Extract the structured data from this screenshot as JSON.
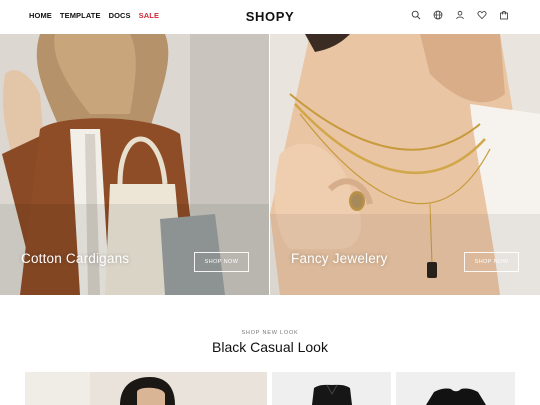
{
  "nav": {
    "items": [
      {
        "label": "HOME"
      },
      {
        "label": "TEMPLATE"
      },
      {
        "label": "DOCS"
      },
      {
        "label": "SALE",
        "color": "#d0283a"
      }
    ]
  },
  "brand": {
    "name": "SHOPY"
  },
  "header_icons": [
    "search-icon",
    "globe-icon",
    "user-icon",
    "heart-icon",
    "bag-icon"
  ],
  "hero": {
    "panels": [
      {
        "caption": "Cotton Cardigans",
        "button": "SHOP NOW"
      },
      {
        "caption": "Fancy Jewelery",
        "button": "SHOP NOW"
      }
    ]
  },
  "section": {
    "eyebrow": "SHOP NEW LOOK",
    "title": "Black Casual Look"
  },
  "colors": {
    "accent_sale": "#d0283a",
    "text": "#111111"
  }
}
